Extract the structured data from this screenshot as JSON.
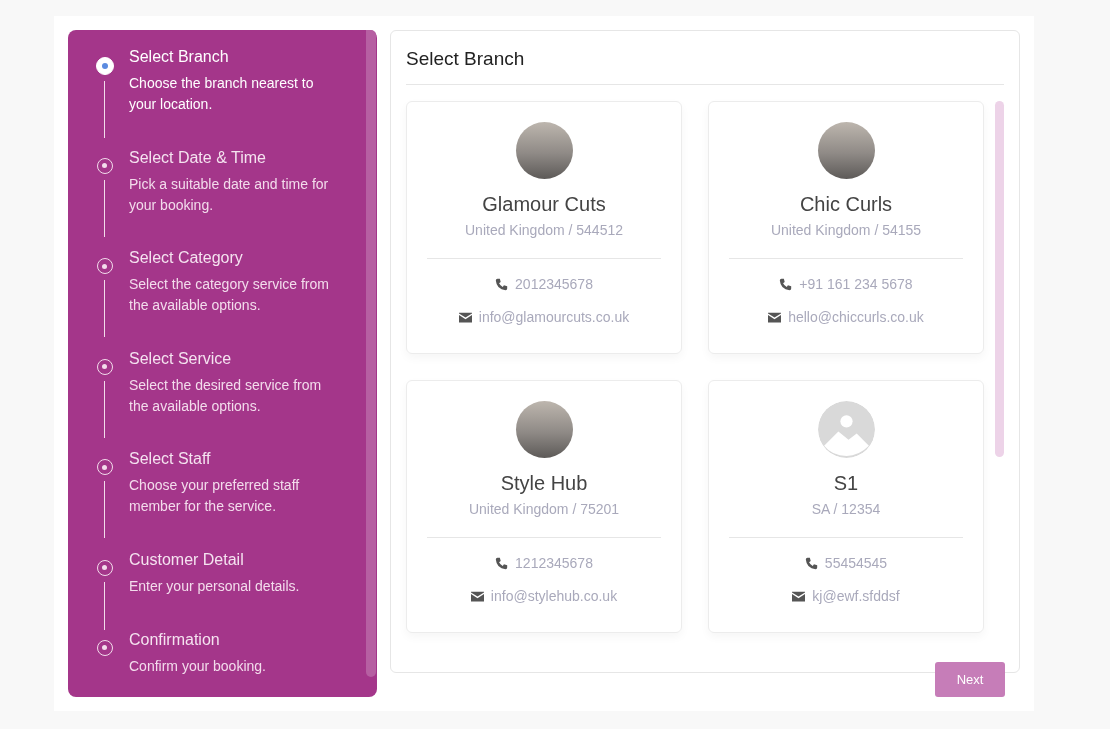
{
  "steps": [
    {
      "title": "Select Branch",
      "description": "Choose the branch nearest to your location.",
      "selected": true
    },
    {
      "title": "Select Date & Time",
      "description": "Pick a suitable date and time for your booking.",
      "selected": false
    },
    {
      "title": "Select Category",
      "description": "Select the category service from the available options.",
      "selected": false
    },
    {
      "title": "Select Service",
      "description": "Select the desired service from the available options.",
      "selected": false
    },
    {
      "title": "Select Staff",
      "description": "Choose your preferred staff member for the service.",
      "selected": false
    },
    {
      "title": "Customer Detail",
      "description": "Enter your personal details.",
      "selected": false
    },
    {
      "title": "Confirmation",
      "description": "Confirm your booking.",
      "selected": false
    }
  ],
  "panel": {
    "title": "Select Branch"
  },
  "branches": [
    {
      "kind": "photo",
      "name": "Glamour Cuts",
      "location": "United Kingdom / 544512",
      "phone": "2012345678",
      "email": "info@glamourcuts.co.uk"
    },
    {
      "kind": "photo",
      "name": "Chic Curls",
      "location": "United Kingdom / 54155",
      "phone": "+91 161 234 5678",
      "email": "hello@chiccurls.co.uk"
    },
    {
      "kind": "photo",
      "name": "Style Hub",
      "location": "United Kingdom / 75201",
      "phone": "1212345678",
      "email": "info@stylehub.co.uk"
    },
    {
      "kind": "placeholder",
      "name": "S1",
      "location": "SA / 12354",
      "phone": "55454545",
      "email": "kj@ewf.sfddsf"
    }
  ],
  "next_button": "Next"
}
